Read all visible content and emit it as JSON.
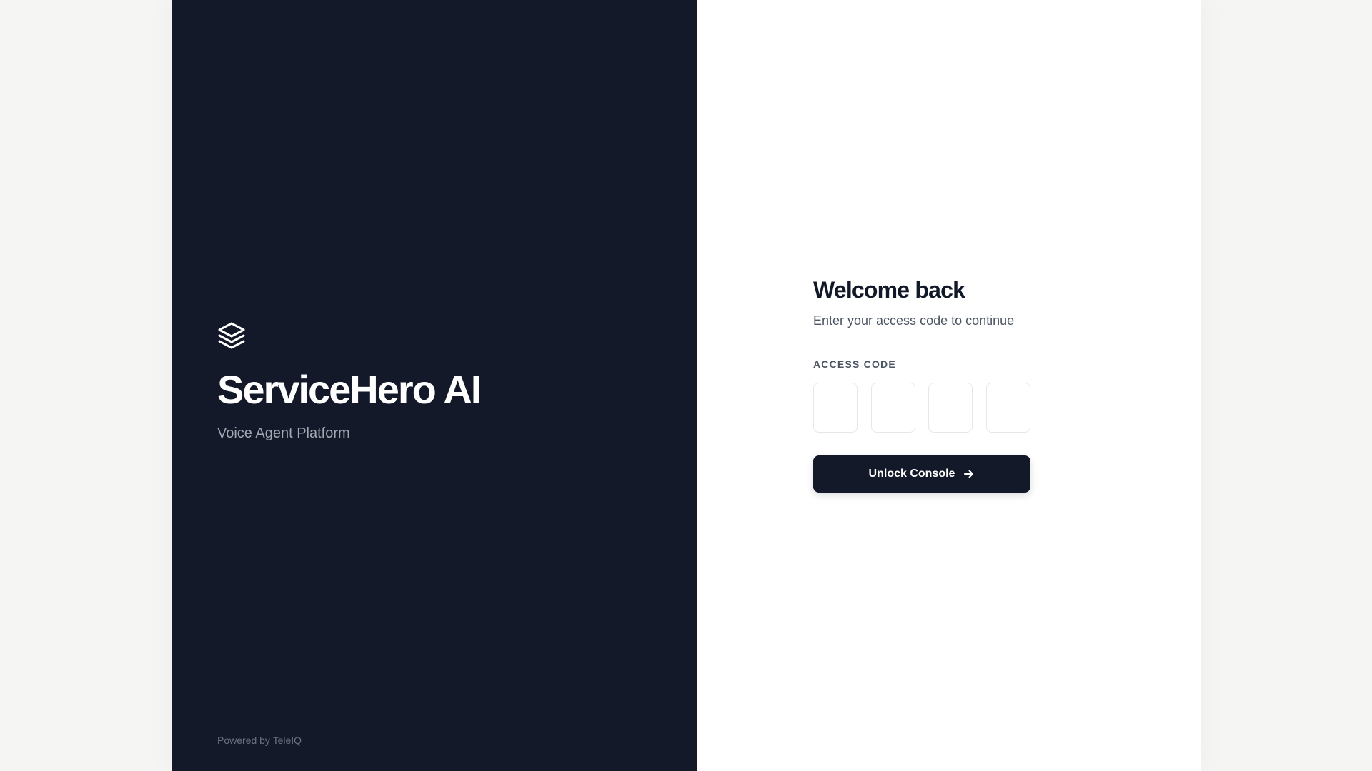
{
  "brand": {
    "logo_icon": "layers-icon",
    "name": "ServiceHero AI",
    "tagline": "Voice Agent Platform",
    "powered_by": "Powered by TeleIQ"
  },
  "login": {
    "title": "Welcome back",
    "subtitle": "Enter your access code to continue",
    "code_label": "ACCESS CODE",
    "code_digits": [
      "",
      "",
      "",
      ""
    ],
    "submit_label": "Unlock Console",
    "submit_icon": "arrow-right-icon"
  },
  "colors": {
    "panel_dark": "#131928",
    "page_background": "#f5f5f4",
    "text_primary": "#111827",
    "text_muted": "#4b5563"
  }
}
